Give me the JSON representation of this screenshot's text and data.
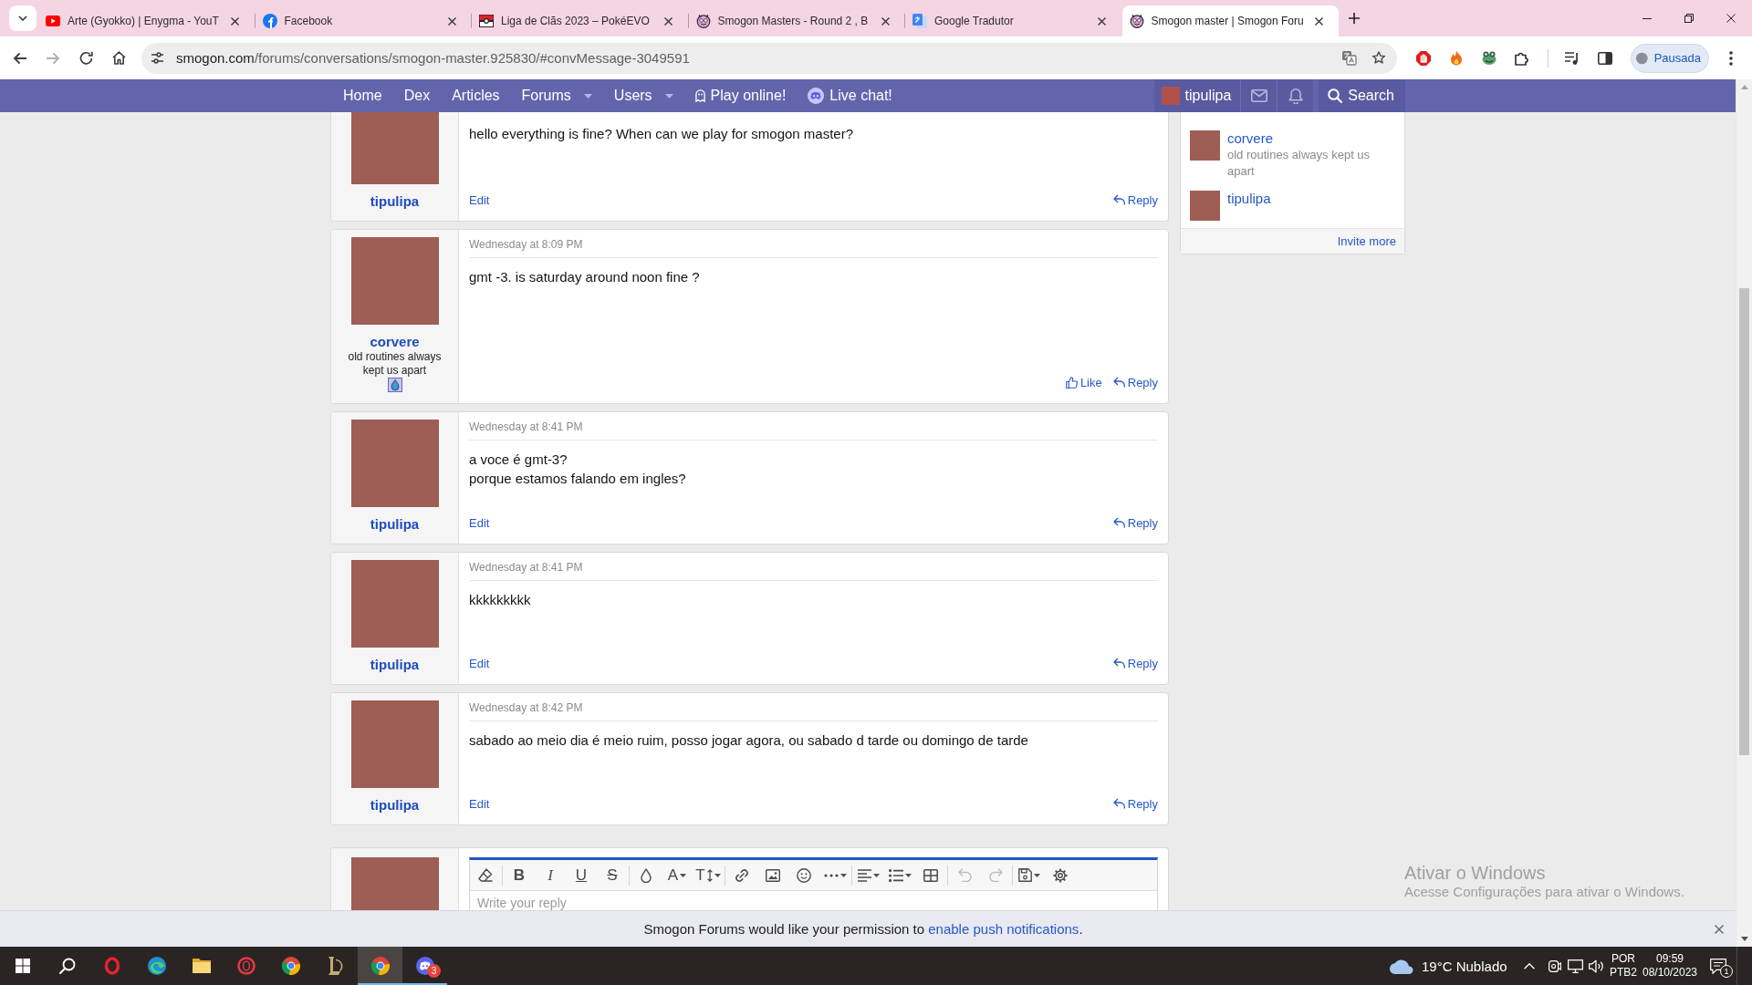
{
  "browser": {
    "tabs": [
      {
        "kind": "video",
        "title": "Arte (Gyokko) | Enygma - YouT",
        "selected": false
      },
      {
        "kind": "social",
        "title": "Facebook",
        "selected": false
      },
      {
        "kind": "ball",
        "title": "Liga de Clãs 2023 – PokéEVO",
        "selected": false
      },
      {
        "kind": "mascot",
        "title": "Smogon Masters - Round 2 , B",
        "selected": false
      },
      {
        "kind": "translate",
        "title": "Google Tradutor",
        "selected": false
      },
      {
        "kind": "mascot",
        "title": "Smogon master | Smogon Foru",
        "selected": true
      }
    ],
    "url": {
      "host": "smogon.com",
      "path": "/forums/conversations/smogon-master.925830/#convMessage-3049591"
    },
    "profile": "Pausada"
  },
  "nav": {
    "items": [
      {
        "kind": "link",
        "label": "Home"
      },
      {
        "kind": "link",
        "label": "Dex"
      },
      {
        "kind": "link",
        "label": "Articles"
      },
      {
        "kind": "menu",
        "label": "Forums"
      },
      {
        "kind": "menu",
        "label": "Users"
      },
      {
        "kind": "play",
        "label": "Play online!"
      },
      {
        "kind": "chat",
        "label": "Live chat!"
      }
    ],
    "user": "tipulipa",
    "search": "Search"
  },
  "posts": [
    {
      "author": "tipulipa",
      "badge": false,
      "lines": [
        "hello everything is fine? When can we play for smogon master?"
      ],
      "actions": [
        {
          "kind": "edit",
          "label": "Edit"
        },
        {
          "kind": "reply",
          "label": "Reply"
        }
      ]
    },
    {
      "author": "corvere",
      "title": "old routines always kept us apart",
      "badge": true,
      "date": "Wednesday at 8:09 PM",
      "lines": [
        "gmt -3. is saturday around noon fine ?"
      ],
      "actions": [
        {
          "kind": "like",
          "label": "Like"
        },
        {
          "kind": "reply",
          "label": "Reply"
        }
      ]
    },
    {
      "author": "tipulipa",
      "badge": false,
      "date": "Wednesday at 8:41 PM",
      "lines": [
        "a voce é gmt-3?",
        "porque estamos falando em ingles?"
      ],
      "actions": [
        {
          "kind": "edit",
          "label": "Edit"
        },
        {
          "kind": "reply",
          "label": "Reply"
        }
      ]
    },
    {
      "author": "tipulipa",
      "badge": false,
      "date": "Wednesday at 8:41 PM",
      "lines": [
        "kkkkkkkkk"
      ],
      "actions": [
        {
          "kind": "edit",
          "label": "Edit"
        },
        {
          "kind": "reply",
          "label": "Reply"
        }
      ]
    },
    {
      "author": "tipulipa",
      "badge": false,
      "date": "Wednesday at 8:42 PM",
      "lines": [
        "sabado ao meio dia é meio ruim, posso jogar agora, ou sabado d tarde ou domingo de tarde"
      ],
      "actions": [
        {
          "kind": "edit",
          "label": "Edit"
        },
        {
          "kind": "reply",
          "label": "Reply"
        }
      ]
    }
  ],
  "reply_editor": {
    "groups": [
      [
        {
          "kind": "eraser",
          "dropdown": false,
          "disabled": false
        }
      ],
      [
        {
          "kind": "bold",
          "glyph": "B",
          "dropdown": false,
          "disabled": false
        },
        {
          "kind": "italic",
          "glyph": "I",
          "dropdown": false,
          "disabled": false
        },
        {
          "kind": "underline",
          "glyph": "U",
          "dropdown": false,
          "disabled": false
        },
        {
          "kind": "strike",
          "glyph": "S",
          "dropdown": false,
          "disabled": false
        }
      ],
      [
        {
          "kind": "drop",
          "dropdown": false,
          "disabled": false
        },
        {
          "kind": "color",
          "glyph": "A",
          "dropdown": true,
          "disabled": false
        },
        {
          "kind": "size",
          "glyph": "T",
          "dropdown": true,
          "disabled": false
        }
      ],
      [
        {
          "kind": "link",
          "dropdown": false,
          "disabled": false
        },
        {
          "kind": "image",
          "dropdown": false,
          "disabled": false
        },
        {
          "kind": "emoji",
          "dropdown": false,
          "disabled": false
        },
        {
          "kind": "more",
          "dropdown": true,
          "disabled": false
        }
      ],
      [
        {
          "kind": "align",
          "dropdown": true,
          "disabled": false
        },
        {
          "kind": "list",
          "dropdown": true,
          "disabled": false
        },
        {
          "kind": "table",
          "dropdown": false,
          "disabled": false
        }
      ],
      [
        {
          "kind": "undo",
          "dropdown": false,
          "disabled": true
        },
        {
          "kind": "redo",
          "dropdown": false,
          "disabled": true
        }
      ],
      [
        {
          "kind": "drafts",
          "dropdown": true,
          "disabled": false
        },
        {
          "kind": "settings",
          "dropdown": false,
          "disabled": false
        }
      ]
    ],
    "placeholder": "Write your reply"
  },
  "participants": [
    {
      "name": "corvere",
      "title": "old routines always kept us apart"
    },
    {
      "name": "tipulipa"
    }
  ],
  "invite": "Invite more",
  "watermark": {
    "title": "Ativar o Windows",
    "text": "Acesse Configurações para ativar o Windows."
  },
  "notice": {
    "text": "Smogon Forums would like your permission to",
    "link": "enable push notifications",
    "end": "."
  },
  "taskbar": {
    "apps": [
      {
        "kind": "ring",
        "selected": false,
        "running": false
      },
      {
        "kind": "swirl",
        "selected": false,
        "running": false
      },
      {
        "kind": "folder",
        "selected": false,
        "running": false
      },
      {
        "kind": "ring2",
        "selected": false,
        "running": false
      },
      {
        "kind": "browser",
        "selected": false,
        "running": false
      },
      {
        "kind": "emblem",
        "selected": false,
        "running": false
      },
      {
        "kind": "browser",
        "selected": true,
        "running": true
      },
      {
        "kind": "chat",
        "selected": false,
        "running": true,
        "badge": "3"
      }
    ],
    "weather": "19°C Nublado",
    "language": "POR",
    "layout": "PTB2",
    "time": "09:59",
    "date": "08/10/2023",
    "notifications": "1"
  }
}
